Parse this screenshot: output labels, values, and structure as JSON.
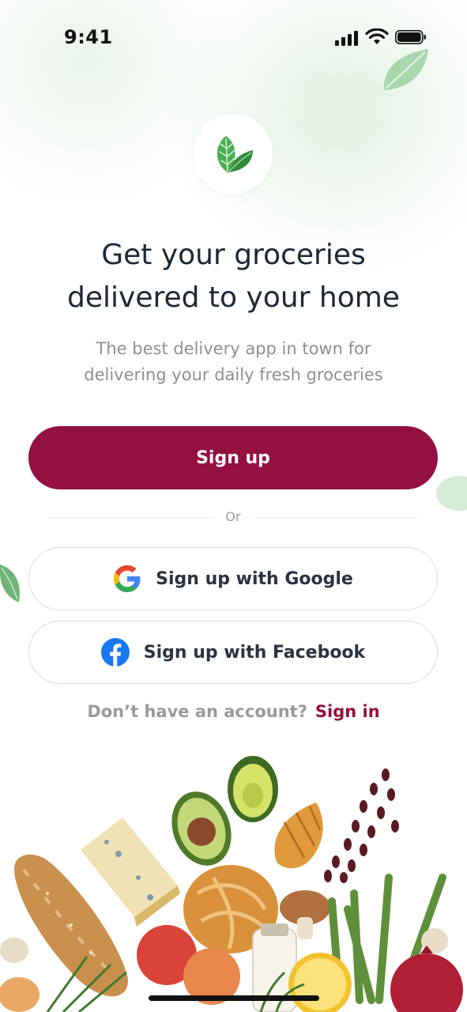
{
  "status_bar": {
    "time": "9:41"
  },
  "hero": {
    "headline_line1": "Get your groceries",
    "headline_line2": "delivered to your home",
    "subtitle_line1": "The best delivery app in town for",
    "subtitle_line2": "delivering your daily fresh groceries"
  },
  "actions": {
    "signup_label": "Sign up",
    "divider_label": "Or",
    "google_label": "Sign up with Google",
    "facebook_label": "Sign up with Facebook"
  },
  "footer": {
    "prompt": "Don’t have an account?",
    "signin_label": "Sign in"
  },
  "colors": {
    "brand": "#931040",
    "leaf_green": "#3e9e4a",
    "facebook_blue": "#1877f2"
  },
  "icons": [
    "leaf-logo-icon",
    "google-icon",
    "facebook-icon",
    "signal-icon",
    "wifi-icon",
    "battery-icon"
  ]
}
